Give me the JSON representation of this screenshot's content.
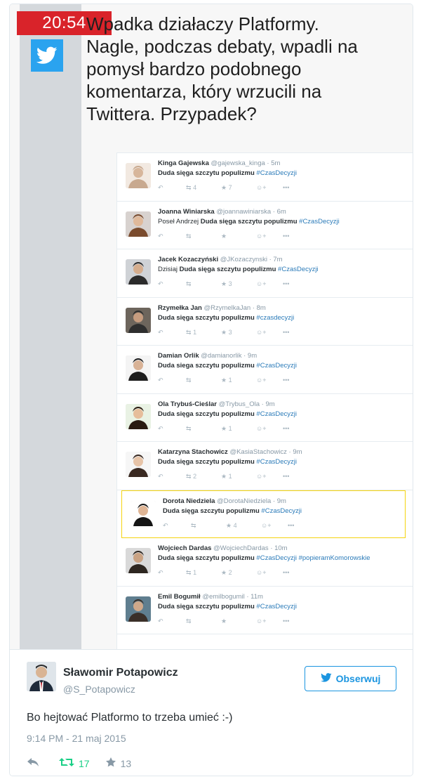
{
  "media": {
    "clock": "20:54",
    "headline": "Wpadka działaczy Platformy.\nNagle, podczas debaty, wpadli na\npomysł bardzo podobnego\nkomentarza, który wrzucili na\nTwittera. Przypadek?",
    "tweets": [
      {
        "name": "Kinga Gajewska",
        "handle": "@gajewska_kinga",
        "time": "· 5m",
        "prefix": "",
        "text": "Duda sięga szczytu populizmu",
        "hashtag": "#CzasDecyzji",
        "extra": "",
        "retweets": "4",
        "favorites": "7"
      },
      {
        "name": "Joanna Winiarska",
        "handle": "@joannawiniarska",
        "time": "· 6m",
        "prefix": "Poseł Andrzej ",
        "text": "Duda sięga szczytu populizmu",
        "hashtag": "#CzasDecyzji",
        "extra": "",
        "retweets": "",
        "favorites": ""
      },
      {
        "name": "Jacek Kozaczyński",
        "handle": "@JKozaczynski",
        "time": "· 7m",
        "prefix": "Dzisiaj ",
        "text": "Duda sięga szczytu populizmu",
        "hashtag": "#CzasDecyzji",
        "extra": "",
        "retweets": "",
        "favorites": "3"
      },
      {
        "name": "Rzymełka Jan",
        "handle": "@RzymelkaJan",
        "time": "· 8m",
        "prefix": "",
        "text": "Duda sięga szczytu populizmu",
        "hashtag": "#czasdecyzji",
        "extra": "",
        "retweets": "1",
        "favorites": "3"
      },
      {
        "name": "Damian Orlik",
        "handle": "@damianorlik",
        "time": "· 9m",
        "prefix": "",
        "text": "Duda siega szczytu populizmu",
        "hashtag": "#CzasDecyzji",
        "extra": "",
        "retweets": "",
        "favorites": "1"
      },
      {
        "name": "Ola Trybuś-Cieślar",
        "handle": "@Trybus_Ola",
        "time": "· 9m",
        "prefix": "",
        "text": "Duda sięga szczytu populizmu",
        "hashtag": "#CzasDecyzji",
        "extra": "",
        "retweets": "",
        "favorites": "1"
      },
      {
        "name": "Katarzyna Stachowicz",
        "handle": "@KasiaStachowicz",
        "time": "· 9m",
        "prefix": "",
        "text": "Duda sięga szczytu populizmu",
        "hashtag": "#CzasDecyzji",
        "extra": "",
        "retweets": "2",
        "favorites": "1"
      },
      {
        "name": "Dorota Niedziela",
        "handle": "@DorotaNiedziela",
        "time": "· 9m",
        "prefix": "",
        "text": "Duda sięga szczytu populizmu",
        "hashtag": "#CzasDecyzji",
        "extra": "",
        "retweets": "",
        "favorites": "4"
      },
      {
        "name": "Wojciech Dardas",
        "handle": "@WojciechDardas",
        "time": "· 10m",
        "prefix": "",
        "text": "Duda sięga szczytu populizmu",
        "hashtag": "#CzasDecyzji",
        "extra": " #popieramKomorowskie",
        "retweets": "1",
        "favorites": "2"
      },
      {
        "name": "Emil Bogumił",
        "handle": "@emilbogumil",
        "time": "· 11m",
        "prefix": "",
        "text": "Duda sięga szczytu populizmu",
        "hashtag": "#CzasDecyzji",
        "extra": "",
        "retweets": "",
        "favorites": ""
      }
    ]
  },
  "tweet": {
    "name": "Sławomir Potapowicz",
    "handle": "@S_Potapowicz",
    "follow_label": "Obserwuj",
    "text": "Bo hejtować Platformo to trzeba umieć :-)",
    "date": "9:14 PM - 21 maj 2015",
    "retweets": "17",
    "favorites": "13"
  },
  "colors": {
    "clock_bg": "#d9232a",
    "twitter_blue": "#2aa3ef",
    "hashtag": "#2b7bb9",
    "retweet_green": "#19cf86",
    "highlight_border": "#f5d40f"
  },
  "icons": {
    "reply": "reply-icon",
    "retweet": "retweet-icon",
    "favorite": "star-icon",
    "follow": "follow-person-icon",
    "more": "more-dots-icon",
    "bird": "twitter-bird-icon"
  }
}
